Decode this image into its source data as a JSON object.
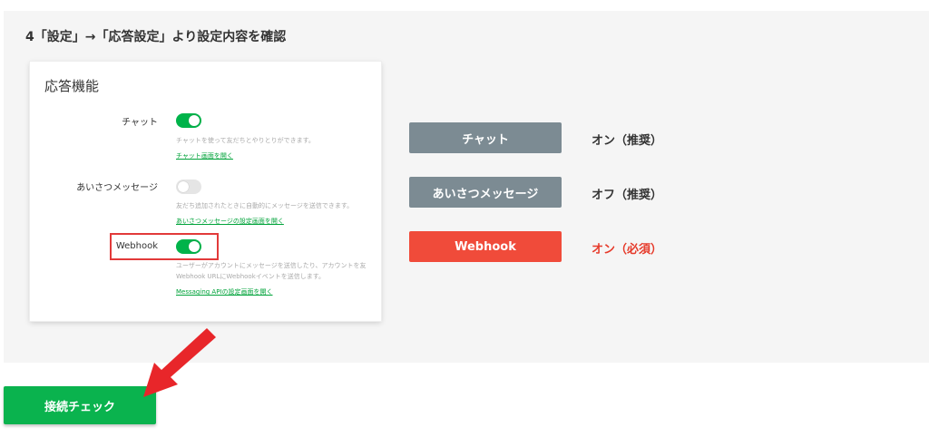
{
  "step": {
    "heading": "4「設定」→「応答設定」より設定内容を確認"
  },
  "card": {
    "title": "応答機能",
    "rows": [
      {
        "label": "チャット",
        "enabled": true,
        "description": "チャットを使って友だちとやりとりができます。",
        "link": "チャット画面を開く"
      },
      {
        "label": "あいさつメッセージ",
        "enabled": false,
        "description": "友だち追加されたときに自動的にメッセージを送信できます。",
        "link": "あいさつメッセージの設定画面を開く"
      },
      {
        "label": "Webhook",
        "enabled": true,
        "description_line1": "ユーザーがアカウントにメッセージを送信したり、アカウントを友",
        "description_line2": "Webhook URLにWebhookイベントを送信します。",
        "link": "Messaging APIの設定画面を開く"
      }
    ]
  },
  "summary": [
    {
      "button_label": "チャット",
      "status": "オン（推奨）"
    },
    {
      "button_label": "あいさつメッセージ",
      "status": "オフ（推奨）"
    },
    {
      "button_label": "Webhook",
      "status": "オン（必須）"
    }
  ],
  "check_button": {
    "label": "接続チェック"
  },
  "colors": {
    "accent_green": "#00b34a",
    "button_gray": "#7c8b93",
    "alert_red": "#f04b3a"
  }
}
